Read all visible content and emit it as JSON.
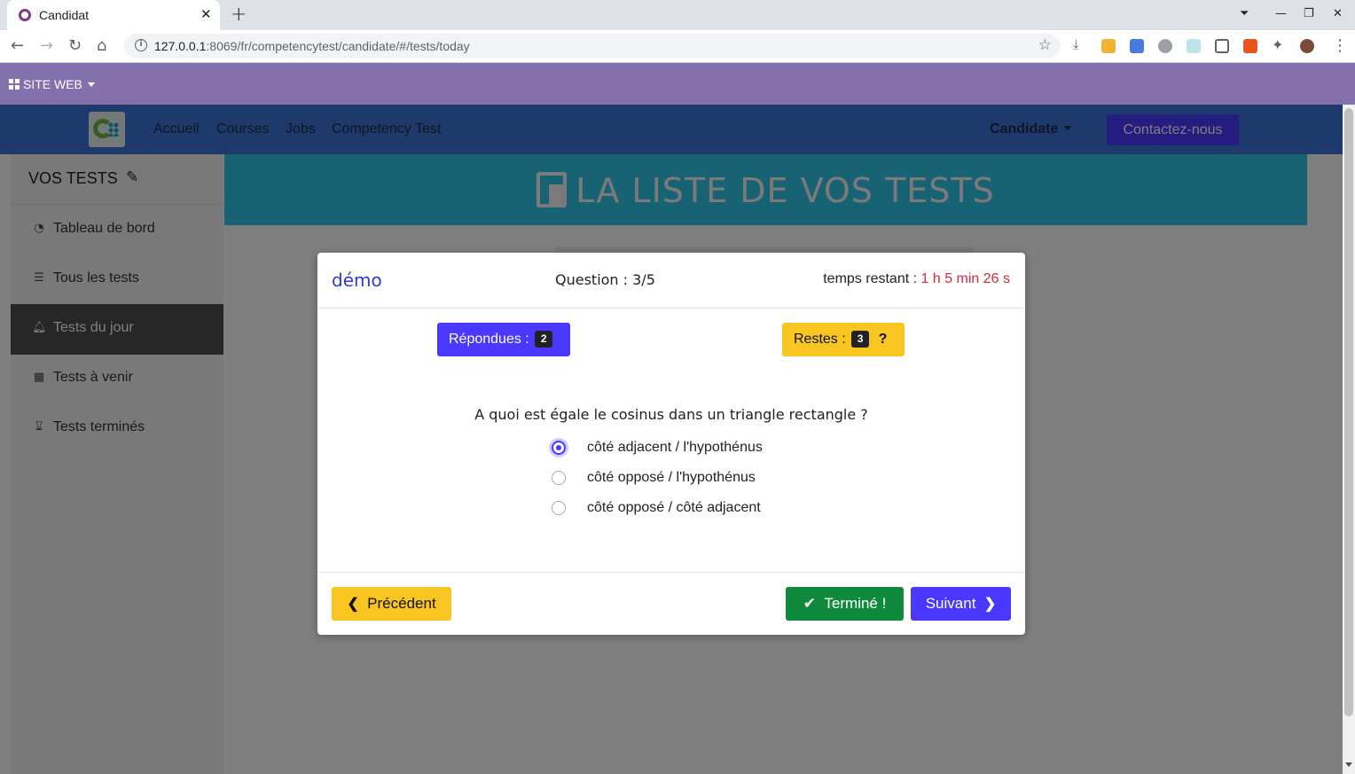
{
  "browser": {
    "tab_title": "Candidat",
    "url_host": "127.0.0.1",
    "url_rest": ":8069/fr/competencytest/candidate/#/tests/today"
  },
  "site_bar": {
    "label": "SITE WEB"
  },
  "navbar": {
    "links": [
      "Accueil",
      "Courses",
      "Jobs",
      "Competency Test"
    ],
    "user": "Candidate",
    "contact": "Contactez-nous"
  },
  "sidebar": {
    "title": "VOS TESTS",
    "items": [
      {
        "label": "Tableau de bord",
        "icon": "dashboard-icon"
      },
      {
        "label": "Tous les tests",
        "icon": "list-icon"
      },
      {
        "label": "Tests du jour",
        "icon": "bell-icon"
      },
      {
        "label": "Tests à venir",
        "icon": "calendar-icon"
      },
      {
        "label": "Tests terminés",
        "icon": "hourglass-icon"
      }
    ]
  },
  "banner": {
    "title": "LA LISTE DE VOS TESTS"
  },
  "modal": {
    "title": "démo",
    "question_counter": "Question : 3/5",
    "time_label": "temps restant : ",
    "time_value": "1 h 5 min 26 s",
    "answered_label": "Répondues :",
    "answered_count": "2",
    "remaining_label": "Restes :",
    "remaining_count": "3",
    "remaining_mark": "?",
    "question": "A quoi est égale le cosinus dans un triangle rectangle ?",
    "options": [
      "côté adjacent / l'hypothénus",
      "côté opposé / l'hypothénus",
      "côté opposé / côté adjacent"
    ],
    "selected_option": "côté adjacent / l'hypothénus",
    "prev_label": "Précédent",
    "done_label": "Terminé !",
    "next_label": "Suivant"
  },
  "colors": {
    "accent": "#4a38ff",
    "warning": "#f9c520",
    "success": "#0f8a3c",
    "site_bar": "#8370ad",
    "navbar": "#3d74d9",
    "banner": "#2ec6e8",
    "timer": "#d7263d"
  }
}
